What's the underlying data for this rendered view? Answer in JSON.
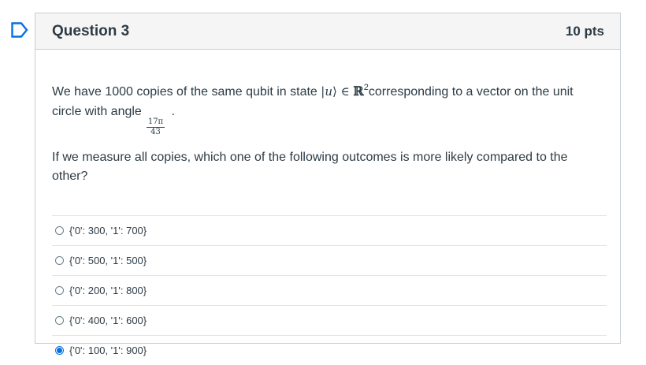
{
  "question": {
    "title": "Question 3",
    "points": "10 pts",
    "text_before_math": "We have 1000 copies of the same qubit in state ",
    "ket_open": "|",
    "ket_var": "u",
    "ket_close": "⟩",
    "element_of": " ∈ ",
    "real_symbol": "ℝ",
    "real_exponent": "2",
    "text_after_math": "corresponding to a vector on the unit circle with angle",
    "angle_numerator": "17π",
    "angle_denominator": "43",
    "angle_trailing": ".",
    "prompt": "If we measure all copies, which one of the following outcomes is more likely compared to the other?"
  },
  "answers": [
    {
      "label": "{'0': 300, '1': 700}",
      "selected": false
    },
    {
      "label": "{'0': 500, '1': 500}",
      "selected": false
    },
    {
      "label": "{'0': 200, '1': 800}",
      "selected": false
    },
    {
      "label": "{'0': 400, '1': 600}",
      "selected": false
    },
    {
      "label": "{'0': 100, '1': 900}",
      "selected": true
    }
  ],
  "colors": {
    "accent": "#0770e3",
    "header_bg": "#f5f5f5",
    "border": "#c7cdd1",
    "text": "#2d3b45"
  },
  "icons": {
    "flag": "bookmark-flag-icon"
  }
}
